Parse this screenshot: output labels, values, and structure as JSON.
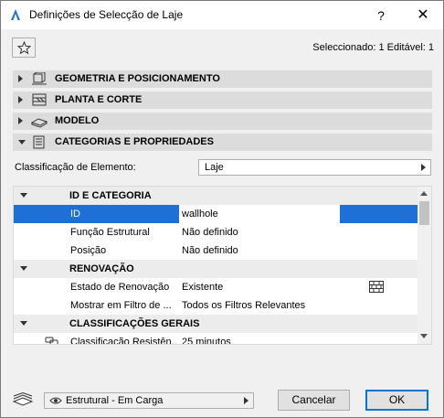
{
  "window": {
    "title": "Definições de Selecção de Laje",
    "help_label": "?",
    "close_label": "✕"
  },
  "toolbar": {
    "selection_status": "Seleccionado: 1 Editável: 1"
  },
  "sections": [
    {
      "label": "GEOMETRIA E POSICIONAMENTO",
      "expanded": false,
      "icon": "geometry-icon"
    },
    {
      "label": "PLANTA E CORTE",
      "expanded": false,
      "icon": "plan-section-icon"
    },
    {
      "label": "MODELO",
      "expanded": false,
      "icon": "model-icon"
    },
    {
      "label": "CATEGORIAS E PROPRIEDADES",
      "expanded": true,
      "icon": "categories-icon"
    }
  ],
  "classification": {
    "label": "Classificação de Elemento:",
    "value": "Laje"
  },
  "grid": {
    "groups": [
      {
        "label": "ID E CATEGORIA"
      },
      {
        "label": "RENOVAÇÃO"
      },
      {
        "label": "CLASSIFICAÇÕES GERAIS"
      }
    ],
    "rows": [
      {
        "name": "ID",
        "value": "wallhole",
        "selected": true
      },
      {
        "name": "Função Estrutural",
        "value": "Não definido"
      },
      {
        "name": "Posição",
        "value": "Não definido"
      },
      {
        "name": "Estado de Renovação",
        "value": "Existente",
        "icon": "brick-wall-icon"
      },
      {
        "name": "Mostrar em Filtro de ...",
        "value": "Todos os Filtros Relevantes"
      },
      {
        "name": "Classificação Resistên...",
        "value": "25 minutos",
        "icon": "link-icon"
      }
    ]
  },
  "footer": {
    "layer_value": "Estrutural - Em Carga",
    "cancel_label": "Cancelar",
    "ok_label": "OK"
  },
  "colors": {
    "selection": "#1e6fd6",
    "section_bg": "#dcdcdc",
    "ok_border": "#0078d7"
  }
}
